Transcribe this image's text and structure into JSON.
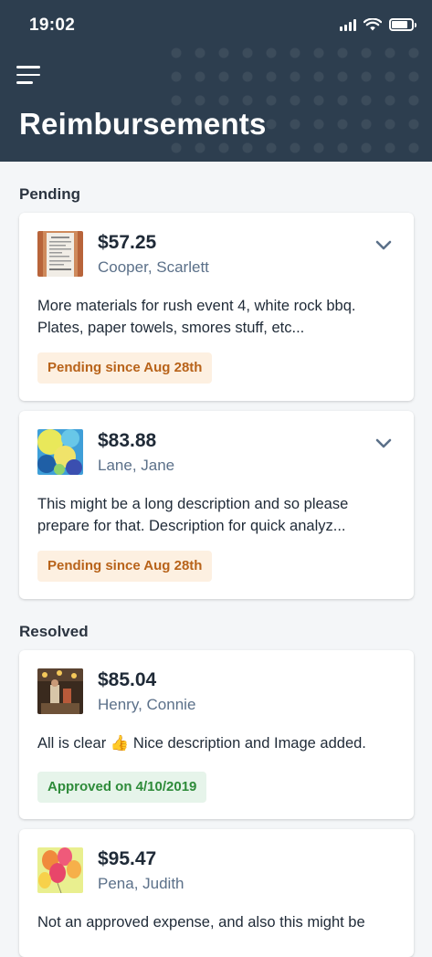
{
  "status_bar": {
    "time": "19:02",
    "icons": [
      "signal-icon",
      "wifi-icon",
      "battery-icon"
    ]
  },
  "header": {
    "title": "Reimbursements",
    "menu_icon": "hamburger-menu-icon"
  },
  "sections": {
    "pending": {
      "label": "Pending"
    },
    "resolved": {
      "label": "Resolved"
    }
  },
  "cards": [
    {
      "amount": "$57.25",
      "person": "Cooper, Scarlett",
      "description": "More materials for rush event 4, white rock bbq. Plates, paper towels, smores stuff, etc...",
      "badge": "Pending since Aug 28th",
      "status": "pending",
      "thumb": "receipt-image"
    },
    {
      "amount": "$83.88",
      "person": "Lane, Jane",
      "description": "This might be a long description and so please prepare for that. Description for quick analyz...",
      "badge": "Pending since Aug 28th",
      "status": "pending",
      "thumb": "abstract-paint-image"
    },
    {
      "amount": "$85.04",
      "person": "Henry, Connie",
      "description": "All is clear 👍 Nice description and Image added.",
      "badge": "Approved on 4/10/2019",
      "status": "approved",
      "thumb": "restaurant-image"
    },
    {
      "amount": "$95.47",
      "person": "Pena, Judith",
      "description": "Not an approved expense, and also this might be",
      "status": "resolved",
      "thumb": "balloons-image"
    }
  ],
  "colors": {
    "header_bg": "#2d3e4f",
    "page_bg": "#f4f6f8",
    "pending_badge_bg": "#fdf0e1",
    "pending_badge_text": "#b8631a",
    "approved_badge_bg": "#e6f4ea",
    "approved_badge_text": "#2e8b3a",
    "person_text": "#5b7089"
  }
}
